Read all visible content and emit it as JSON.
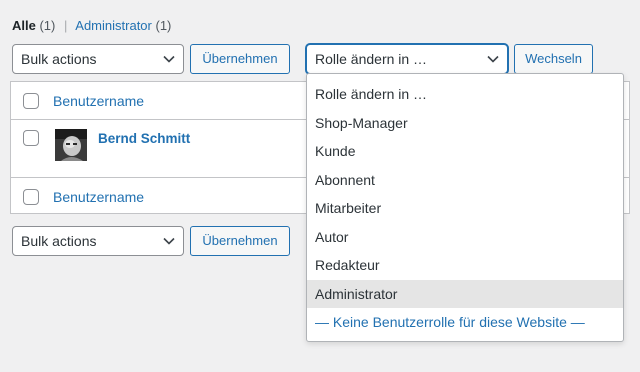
{
  "views": {
    "all_label": "Alle",
    "all_count": "(1)",
    "separator": "|",
    "admin_label": "Administrator",
    "admin_count": "(1)"
  },
  "top_nav": {
    "bulk_select": "Bulk actions",
    "apply_button": "Übernehmen",
    "role_select": "Rolle ändern in …",
    "change_button": "Wechseln"
  },
  "table": {
    "column_header": "Benutzername",
    "footer_header": "Benutzername",
    "rows": [
      {
        "name": "Bernd Schmitt"
      }
    ]
  },
  "bottom_nav": {
    "bulk_select": "Bulk actions",
    "apply_button": "Übernehmen"
  },
  "role_dropdown": {
    "options": [
      "Rolle ändern in …",
      "Shop-Manager",
      "Kunde",
      "Abonnent",
      "Mitarbeiter",
      "Autor",
      "Redakteur",
      "Administrator",
      "— Keine Benutzerrolle für diese Website —"
    ],
    "highlighted": "Administrator"
  },
  "colors": {
    "accent": "#2271b1",
    "background": "#f0f0f1",
    "highlight": "#e5e5e5"
  },
  "icons": [
    "chevron-down-icon",
    "avatar-photo"
  ]
}
